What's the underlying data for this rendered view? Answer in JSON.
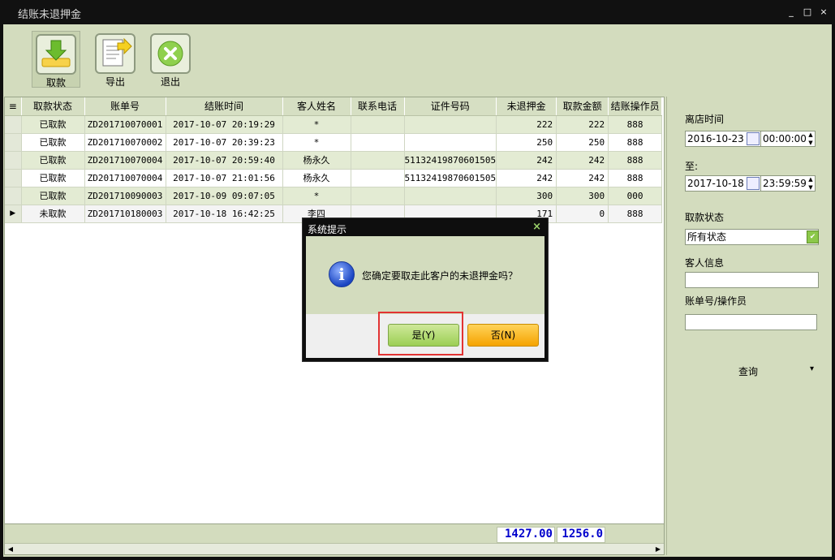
{
  "window": {
    "title": "结账未退押金",
    "controls": [
      "_",
      "□",
      "×"
    ]
  },
  "toolbar": {
    "buttons": [
      {
        "label": "取款",
        "icon": "withdraw-arrow-icon"
      },
      {
        "label": "导出",
        "icon": "export-document-icon"
      },
      {
        "label": "退出",
        "icon": "exit-x-icon"
      }
    ]
  },
  "grid": {
    "row_header_icon": "≡",
    "columns": [
      "取款状态",
      "账单号",
      "结账时间",
      "客人姓名",
      "联系电话",
      "证件号码",
      "未退押金",
      "取款金额",
      "结账操作员"
    ],
    "rows": [
      [
        "已取款",
        "ZD201710070001",
        "2017-10-07 20:19:29",
        "*",
        "",
        "",
        "222",
        "222",
        "888"
      ],
      [
        "已取款",
        "ZD201710070002",
        "2017-10-07 20:39:23",
        "*",
        "",
        "",
        "250",
        "250",
        "888"
      ],
      [
        "已取款",
        "ZD201710070004",
        "2017-10-07 20:59:40",
        "杨永久",
        "",
        "51132419870601505",
        "242",
        "242",
        "888"
      ],
      [
        "已取款",
        "ZD201710070004",
        "2017-10-07 21:01:56",
        "杨永久",
        "",
        "51132419870601505",
        "242",
        "242",
        "888"
      ],
      [
        "已取款",
        "ZD201710090003",
        "2017-10-09 09:07:05",
        "*",
        "",
        "",
        "300",
        "300",
        "000"
      ],
      [
        "未取款",
        "ZD201710180003",
        "2017-10-18 16:42:25",
        "李四",
        "",
        "",
        "171",
        "0",
        "888"
      ]
    ],
    "current_row_marker": "▶",
    "totals": {
      "unreturned": "1427.00",
      "withdrawn": "1256.0"
    }
  },
  "panel": {
    "checkout_time_label": "离店时间",
    "from_date": "2016-10-23",
    "from_time": "00:00:00",
    "to_label": "至:",
    "to_date": "2017-10-18",
    "to_time": "23:59:59",
    "status_label": "取款状态",
    "status_value": "所有状态",
    "guest_label": "客人信息",
    "guest_value": "",
    "bill_label": "账单号/操作员",
    "bill_value": "",
    "query_label": "查询",
    "query_arrow": "▾"
  },
  "dialog": {
    "title": "系统提示",
    "close": "×",
    "icon": "info-icon",
    "message": "您确定要取走此客户的未退押金吗？",
    "yes_label": "是(Y)",
    "no_label": "否(N)"
  }
}
